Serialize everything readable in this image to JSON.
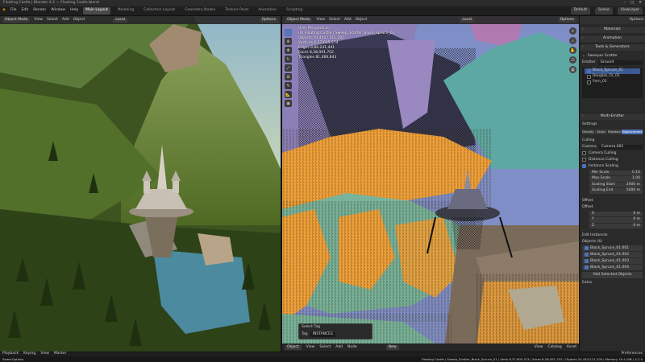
{
  "window": {
    "title": "Floating Castle | Blender 4.2 — Floating Castle.blend",
    "title_right": "Blender 4.2"
  },
  "menubar": {
    "items": [
      "File",
      "Edit",
      "Render",
      "Window",
      "Help"
    ],
    "workspaces": [
      "Main Layout",
      "Modeling",
      "Collection Layout",
      "Geometry Nodes",
      "Texture Paint",
      "Animation",
      "Scripting"
    ],
    "active_workspace": "Main Layout",
    "scene_label": "Default",
    "layer_label": "Scene",
    "view_layer": "ViewLayer"
  },
  "left_viewport": {
    "mode": "Object Mode",
    "menus": [
      "View",
      "Select",
      "Add",
      "Object"
    ],
    "transform": "Local",
    "options": "Options"
  },
  "right_viewport": {
    "mode": "Object Mode",
    "menus": [
      "View",
      "Select",
      "Add",
      "Object"
    ],
    "transform": "Local",
    "options": "Options",
    "info": {
      "view": "User Perspective",
      "collection": "(0) Floating Castle | Sweep_Scatter_Black_Spruce_01",
      "objects": "Objects    10,442 / 111,205",
      "vertices": "Vertices   6,37,605,574",
      "edges": "Edges      8,86,241,441",
      "faces": "Faces      8,38,091,702",
      "triangles": "Triangles  81,466,843"
    },
    "op_panel": {
      "title": "Select Tag",
      "field_label": "Tag",
      "field_value": "INSTANCES"
    }
  },
  "sidebar": {
    "header_label": "Options",
    "sections_top": [
      "Materials",
      "Animation",
      "Tools & Generators"
    ],
    "sweep_scatter": {
      "title": "Sweeper Scatter",
      "emitter_label": "Emitter",
      "emitter_value": "Ground",
      "systems": [
        "Black_Spruce_01",
        "Douglas_Fir_01",
        "Fern_01"
      ],
      "selected_system": "Black_Spruce_01"
    },
    "multi_emitter": "Multi-Emitter",
    "settings_label": "Settings",
    "setting_tabs": [
      "Density",
      "Scale",
      "Rotation",
      "Displacement"
    ],
    "active_setting_tab": "Displacement",
    "culling": {
      "title": "Culling",
      "camera_label": "Camera",
      "camera_value": "Camera.001",
      "camera_culling": "Camera Culling",
      "distance_culling": "Distance Culling",
      "instance_scaling": "Instance Scaling",
      "min_scale_label": "Min Scale",
      "min_scale": "0.10",
      "max_scale_label": "Max Scale",
      "max_scale": "1.00",
      "scaling_start_label": "Scaling Start",
      "scaling_start": "2000 m",
      "scaling_end_label": "Scaling End",
      "scaling_end": "5000 m"
    },
    "offset": {
      "title": "Offset",
      "sub": "Offset",
      "axes": [
        "X",
        "Y",
        "Z"
      ],
      "values": [
        "0 m",
        "0 m",
        "0 m"
      ]
    },
    "edit_instances": "Edit Instances",
    "objects_label": "Objects (4)",
    "objects": [
      "Black_Spruce_01.001",
      "Black_Spruce_01.002",
      "Black_Spruce_01.003",
      "Black_Spruce_01.004"
    ],
    "add_selected": "Add Selected Objects",
    "extra": "Extra"
  },
  "footer": {
    "object_menu": "Object",
    "menus": [
      "View",
      "Select",
      "Add",
      "Node"
    ],
    "new_label": "New",
    "right_menus": [
      "View",
      "Catalog",
      "Asset"
    ],
    "preferences": "Preferences",
    "playback": "Playback",
    "keying": "Keying",
    "view": "View",
    "marker": "Marker"
  },
  "status": {
    "left": "Select",
    "mid": "Options",
    "right": "Floating Castle | Sweep_Scatter_Black_Spruce_01 | Verts 6,37,605,574 | Faces 8,38,091,702 | Objects 10,442/111,205 | Memory 19.4 GiB | 4.2.0"
  },
  "colors": {
    "accent": "#4d72b8",
    "scatter_orange": "#f2a23a",
    "rock_teal": "#5ea8a4",
    "ground_teal": "#78b49c",
    "sky_blue": "#7f8ec6",
    "mountain_purple": "#6a5a9a",
    "forest_green": "#4e6a22"
  }
}
